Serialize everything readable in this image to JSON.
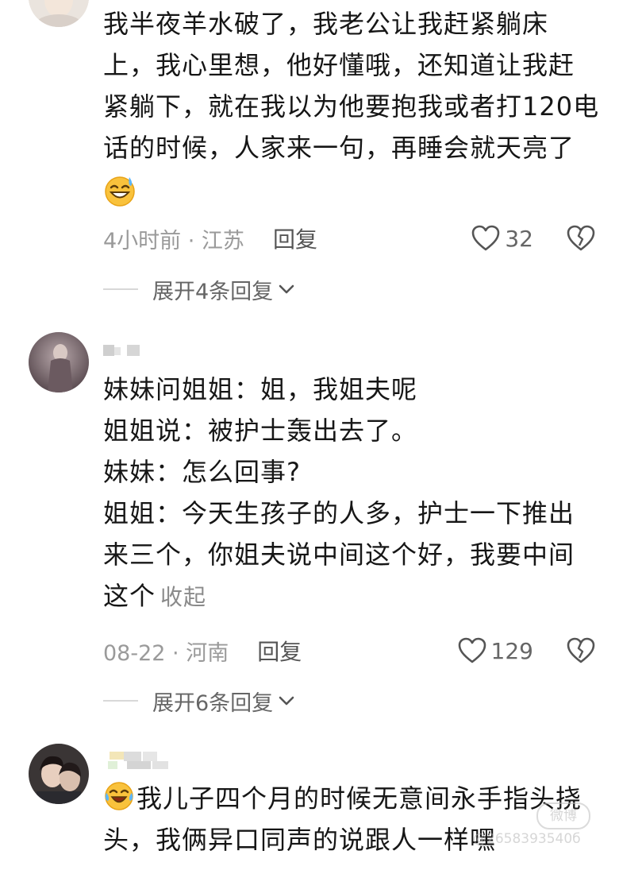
{
  "comments": [
    {
      "lines": [
        "我半夜羊水破了，我老公让我赶紧躺床",
        "上，我心里想，他好懂哦，还知道让我赶",
        "紧躺下，就在我以为他要抱我或者打120电",
        "话的时候，人家来一句，再睡会就天亮了"
      ],
      "emoji": "sweat-smile-emoji",
      "time_location": "4小时前 · 江苏",
      "reply_label": "回复",
      "likes": "32",
      "expand_label": "展开4条回复"
    },
    {
      "lines": [
        "妹妹问姐姐：姐，我姐夫呢",
        "姐姐说：被护士轰出去了。",
        "妹妹：怎么回事?",
        "姐姐：今天生孩子的人多，护士一下推出",
        "来三个，你姐夫说中间这个好，我要中间",
        "这个"
      ],
      "collapse_label": "收起",
      "time_location": "08-22 · 河南",
      "reply_label": "回复",
      "likes": "129",
      "expand_label": "展开6条回复"
    },
    {
      "lines": [
        "我儿子四个月的时候无意间永手指头挠",
        "头，我俩异口同声的说跟人一样嘿"
      ],
      "emoji": "crying-laughing-emoji"
    }
  ],
  "watermark": {
    "badge": "微博",
    "number": "@2658393540б"
  }
}
